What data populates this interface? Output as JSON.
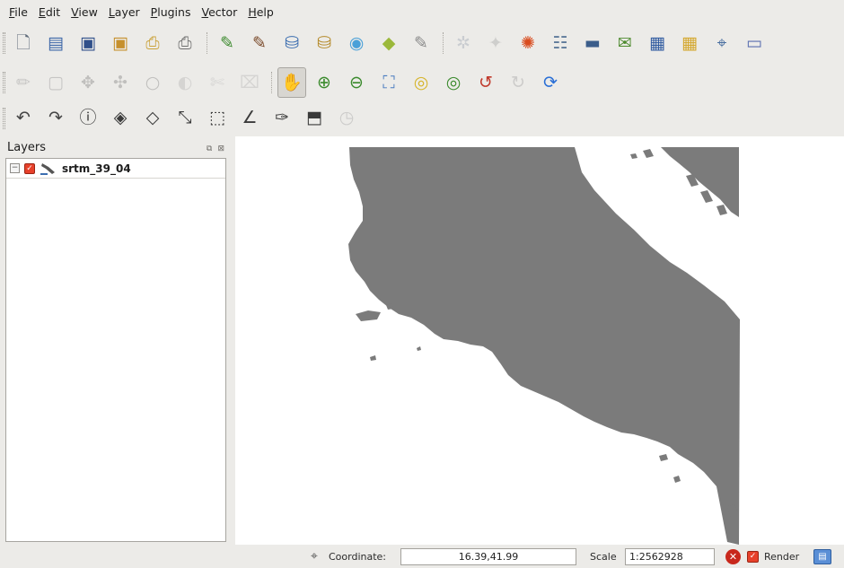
{
  "menu": [
    "File",
    "Edit",
    "View",
    "Layer",
    "Plugins",
    "Vector",
    "Help"
  ],
  "toolbars": {
    "row1": [
      {
        "name": "new-project-icon",
        "glyph": "🗋",
        "color": "#5f6b7a"
      },
      {
        "name": "open-project-icon",
        "glyph": "▤",
        "color": "#3d67a8"
      },
      {
        "name": "save-project-icon",
        "glyph": "▣",
        "color": "#2f4f8a"
      },
      {
        "name": "save-project-as-icon",
        "glyph": "▣",
        "color": "#c6902c"
      },
      {
        "name": "print-composer-icon",
        "glyph": "⎙",
        "color": "#caa23a"
      },
      {
        "name": "print-icon",
        "glyph": "⎙",
        "color": "#6f6f6f"
      },
      {
        "sep": true
      },
      {
        "name": "add-vector-layer-icon",
        "glyph": "✎",
        "color": "#3c8a2e"
      },
      {
        "name": "add-raster-layer-icon",
        "glyph": "✎",
        "color": "#7a4a2a"
      },
      {
        "name": "add-postgis-layer-icon",
        "glyph": "⛁",
        "color": "#3c6eb0"
      },
      {
        "name": "add-spatialite-layer-icon",
        "glyph": "⛁",
        "color": "#b58b2c"
      },
      {
        "name": "add-wms-layer-icon",
        "glyph": "◉",
        "color": "#4aa0d8"
      },
      {
        "name": "add-wfs-layer-icon",
        "glyph": "◆",
        "color": "#9bb83a"
      },
      {
        "name": "new-vector-layer-icon",
        "glyph": "✎",
        "color": "#8a8a8a"
      },
      {
        "sep": true
      },
      {
        "name": "remove-layer-icon",
        "glyph": "✲",
        "color": "#7ea2cf",
        "disabled": true
      },
      {
        "name": "identify-plugin-icon",
        "glyph": "✦",
        "color": "#a0a0a0",
        "disabled": true
      },
      {
        "name": "mapserver-export-icon",
        "glyph": "✺",
        "color": "#d94c1f"
      },
      {
        "name": "attribute-table-icon",
        "glyph": "☷",
        "color": "#5e7a9a"
      },
      {
        "name": "scale-bar-icon",
        "glyph": "▬",
        "color": "#3b5d8a"
      },
      {
        "name": "annotation-icon",
        "glyph": "✉",
        "color": "#4d8a2e"
      },
      {
        "name": "raster-calculator-icon",
        "glyph": "▦",
        "color": "#2f5aa0"
      },
      {
        "name": "raster-plugin-icon",
        "glyph": "▦",
        "color": "#d4a72c"
      },
      {
        "name": "georeferencer-icon",
        "glyph": "⌖",
        "color": "#4a6fa0"
      },
      {
        "name": "text-label-icon",
        "glyph": "▭",
        "color": "#5b6fb0"
      }
    ],
    "row2": [
      {
        "name": "toggle-editing-icon",
        "glyph": "✏",
        "color": "#8a8a8a",
        "disabled": true
      },
      {
        "name": "save-edits-icon",
        "glyph": "▢",
        "color": "#8a8a8a",
        "disabled": true
      },
      {
        "name": "move-feature-icon",
        "glyph": "✥",
        "color": "#7a7a7a",
        "disabled": true
      },
      {
        "name": "node-tool-icon",
        "glyph": "✣",
        "color": "#7a7a7a",
        "disabled": true
      },
      {
        "name": "add-ring-icon",
        "glyph": "○",
        "color": "#7a7a7a",
        "disabled": true
      },
      {
        "name": "add-island-icon",
        "glyph": "◐",
        "color": "#b0b0b0",
        "disabled": true
      },
      {
        "name": "split-features-icon",
        "glyph": "✄",
        "color": "#b0b0b0",
        "disabled": true
      },
      {
        "name": "delete-selected-icon",
        "glyph": "⌧",
        "color": "#b0b0b0",
        "disabled": true
      },
      {
        "sep": true
      },
      {
        "name": "pan-icon",
        "glyph": "✋",
        "color": "#2f6ab8",
        "active": true
      },
      {
        "name": "zoom-in-icon",
        "glyph": "⊕",
        "color": "#3a8a2c"
      },
      {
        "name": "zoom-out-icon",
        "glyph": "⊖",
        "color": "#3a8a2c"
      },
      {
        "name": "zoom-full-icon",
        "glyph": "⛶",
        "color": "#4a7cc0"
      },
      {
        "name": "zoom-to-selection-icon",
        "glyph": "◎",
        "color": "#d6b42a"
      },
      {
        "name": "zoom-to-layer-icon",
        "glyph": "◎",
        "color": "#3a8a2c"
      },
      {
        "name": "zoom-last-icon",
        "glyph": "↺",
        "color": "#c0392b"
      },
      {
        "name": "zoom-next-icon",
        "glyph": "↻",
        "color": "#9a9a9a",
        "disabled": true
      },
      {
        "name": "refresh-icon",
        "glyph": "⟳",
        "color": "#2a6fd6"
      }
    ],
    "row3": [
      {
        "name": "undo-icon",
        "glyph": "↶",
        "color": "#444444"
      },
      {
        "name": "redo-icon",
        "glyph": "↷",
        "color": "#444444"
      },
      {
        "name": "identify-features-icon",
        "glyph": "ⓘ",
        "color": "#3a3a3a"
      },
      {
        "name": "select-features-icon",
        "glyph": "◈",
        "color": "#3a3a3a"
      },
      {
        "name": "deselect-features-icon",
        "glyph": "◇",
        "color": "#3a3a3a"
      },
      {
        "name": "measure-line-icon",
        "glyph": "⤡",
        "color": "#3a3a3a"
      },
      {
        "name": "measure-area-icon",
        "glyph": "⬚",
        "color": "#3a3a3a"
      },
      {
        "name": "measure-angle-icon",
        "glyph": "∠",
        "color": "#3a3a3a"
      },
      {
        "name": "map-tips-icon",
        "glyph": "✑",
        "color": "#3a3a3a"
      },
      {
        "name": "new-bookmark-icon",
        "glyph": "⬒",
        "color": "#3a3a3a"
      },
      {
        "name": "show-bookmarks-icon",
        "glyph": "◷",
        "color": "#9a9a9a",
        "disabled": true
      }
    ]
  },
  "layers_panel": {
    "title": "Layers",
    "layers": [
      {
        "name": "srtm_39_04",
        "visible": true
      }
    ]
  },
  "map": {
    "land_color": "#7b7b7b",
    "sea_color": "#ffffff"
  },
  "statusbar": {
    "coordinate_label": "Coordinate:",
    "coordinate_value": "16.39,41.99",
    "scale_label": "Scale",
    "scale_value": "1:2562928",
    "render_label": "Render"
  }
}
